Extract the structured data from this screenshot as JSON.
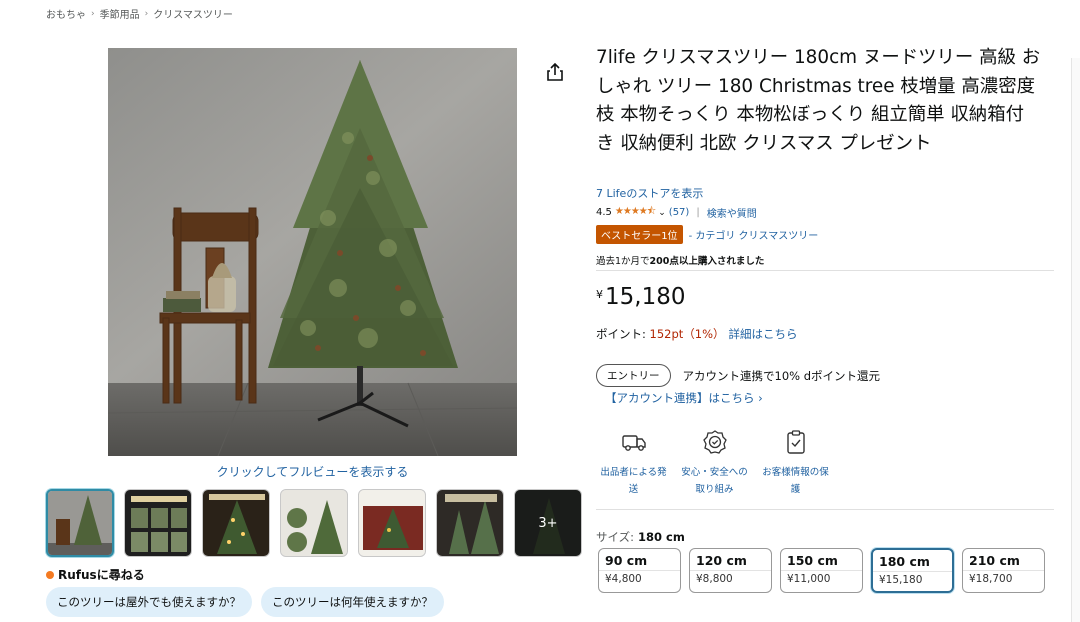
{
  "breadcrumb": [
    "おもちゃ",
    "季節用品",
    "クリスマスツリー"
  ],
  "gallery": {
    "fullview_link": "クリックしてフルビューを表示する",
    "more_label": "3+"
  },
  "rufus": {
    "label": "Rufusに尋ねる",
    "chips": [
      "このツリーは屋外でも使えますか？",
      "このツリーは何年使えますか？"
    ]
  },
  "product": {
    "title": "7life クリスマスツリー 180cm ヌードツリー 高級 おしゃれ ツリー 180 Christmas tree 枝増量 高濃密度枝 本物そっくり 本物松ぼっくり 組立簡単 収納箱付き 収納便利 北欧 クリスマス プレゼント",
    "store_link": "7 Lifeのストアを表示",
    "rating": "4.5",
    "stars": "★★★★⯪",
    "review_count": "(57)",
    "qa_link": "検索や質問",
    "best_badge": "ベストセラー1位",
    "category_link": "- カテゴリ クリスマスツリー",
    "purchased_prefix": "過去1か月で",
    "purchased_bold": "200点以上購入されました",
    "price_symbol": "¥",
    "price": "15,180",
    "points_label": "ポイント: ",
    "points_value": "152pt（1%）",
    "points_link": "詳細はこちら",
    "entry_pill": "エントリー",
    "entry_text": "アカウント連携で10% dポイント還元",
    "account_link": "【アカウント連携】はこちら ›"
  },
  "features": [
    {
      "icon": "delivery-truck-icon",
      "label": "出品者による発送"
    },
    {
      "icon": "safety-badge-icon",
      "label": "安心・安全への取り組み"
    },
    {
      "icon": "privacy-clipboard-icon",
      "label": "お客様情報の保護"
    }
  ],
  "size": {
    "label": "サイズ:",
    "selected": "180 cm",
    "options": [
      {
        "size": "90 cm",
        "price": "¥4,800"
      },
      {
        "size": "120 cm",
        "price": "¥8,800"
      },
      {
        "size": "150 cm",
        "price": "¥11,000"
      },
      {
        "size": "180 cm",
        "price": "¥15,180"
      },
      {
        "size": "210 cm",
        "price": "¥18,700"
      }
    ]
  },
  "colors": {
    "link": "#2162a1",
    "best_badge": "#c45500",
    "price_red": "#b12704",
    "star": "#de7921",
    "chip_bg": "#dfeffa"
  }
}
